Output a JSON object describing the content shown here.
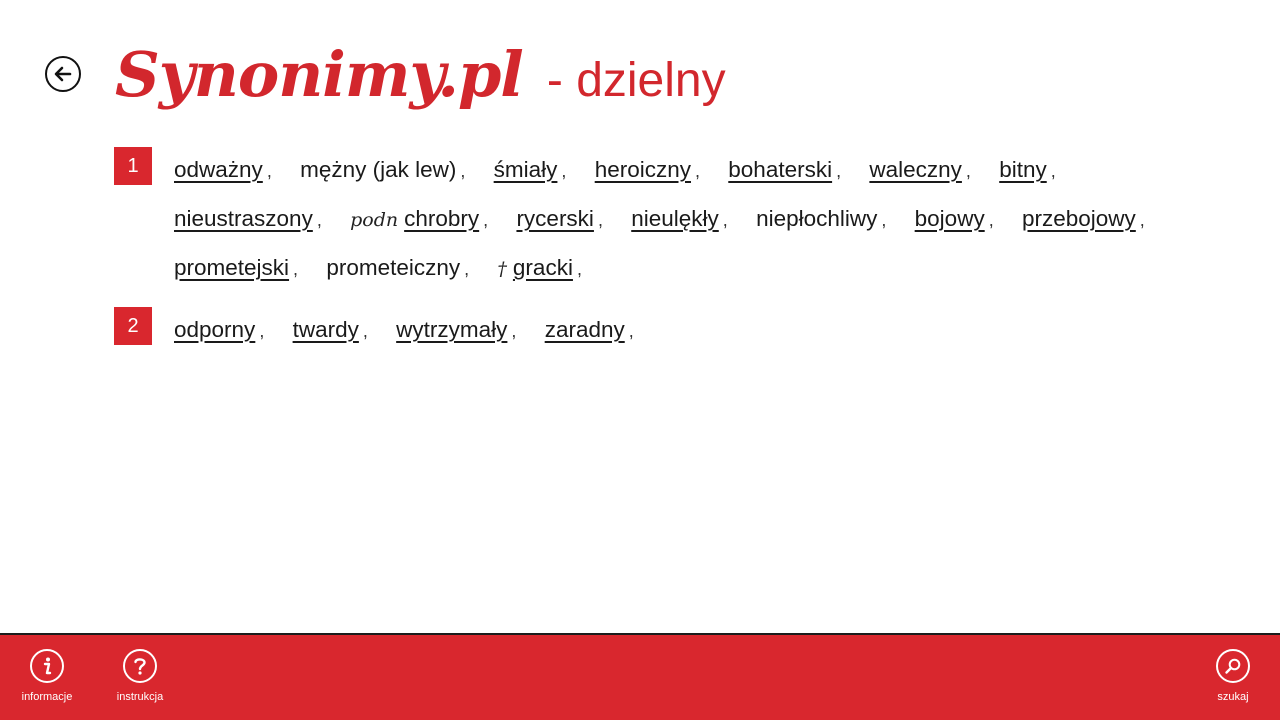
{
  "header": {
    "logo": "Synonimy.pl",
    "word": "- dzielny"
  },
  "senses": [
    {
      "number": "1",
      "words": [
        {
          "text": "odważny",
          "link": true
        },
        {
          "text": "mężny (jak lew)",
          "link": false
        },
        {
          "text": "śmiały",
          "link": true
        },
        {
          "text": "heroiczny",
          "link": true
        },
        {
          "text": "bohaterski",
          "link": true
        },
        {
          "text": "waleczny",
          "link": true
        },
        {
          "text": "bitny",
          "link": true
        },
        {
          "text": "nieustraszony",
          "link": true
        },
        {
          "text": "chrobry",
          "link": true,
          "qualifier": "podn"
        },
        {
          "text": "rycerski",
          "link": true
        },
        {
          "text": "nieulękły",
          "link": true
        },
        {
          "text": "niepłochliwy",
          "link": false
        },
        {
          "text": "bojowy",
          "link": true
        },
        {
          "text": "przebojowy",
          "link": true
        },
        {
          "text": "prometejski",
          "link": true
        },
        {
          "text": "prometeiczny",
          "link": false
        },
        {
          "text": "gracki",
          "link": true,
          "qualifier": "†"
        }
      ]
    },
    {
      "number": "2",
      "words": [
        {
          "text": "odporny",
          "link": true
        },
        {
          "text": "twardy",
          "link": true
        },
        {
          "text": "wytrzymały",
          "link": true
        },
        {
          "text": "zaradny",
          "link": true
        }
      ]
    }
  ],
  "comma": ",",
  "appbar": {
    "info_label": "informacje",
    "help_label": "instrukcja",
    "search_label": "szukaj"
  },
  "colors": {
    "brand": "#d9272e"
  }
}
